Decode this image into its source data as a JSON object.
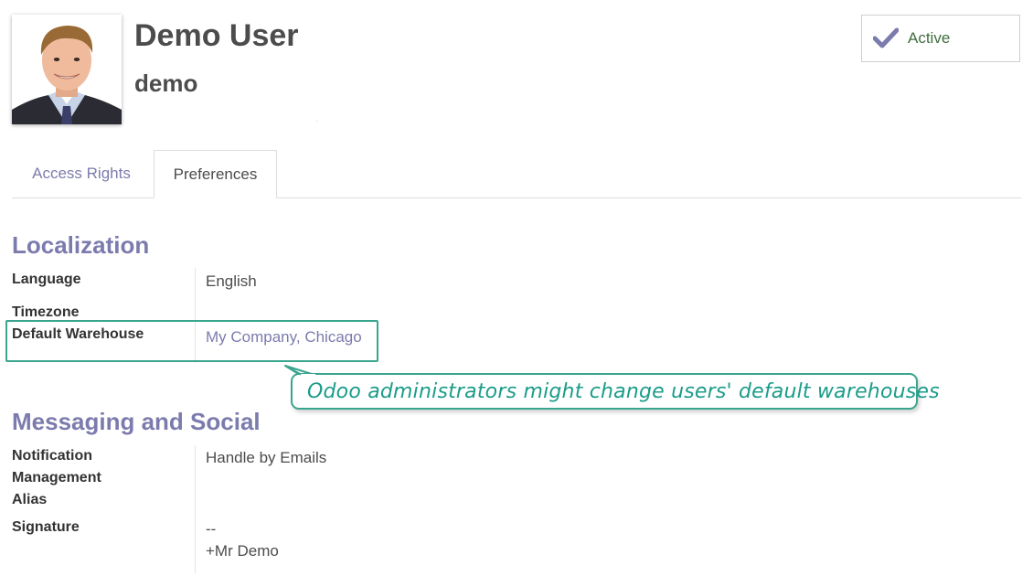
{
  "user": {
    "name": "Demo User",
    "login": "demo"
  },
  "status": {
    "label": "Active"
  },
  "tabs": [
    {
      "label": "Access Rights",
      "active": false
    },
    {
      "label": "Preferences",
      "active": true
    }
  ],
  "localization": {
    "title": "Localization",
    "language_label": "Language",
    "language_value": "English",
    "timezone_label": "Timezone",
    "warehouse_label": "Default Warehouse",
    "warehouse_value": "My Company, Chicago"
  },
  "messaging": {
    "title": "Messaging and Social",
    "notification_label_1": "Notification",
    "notification_label_2": "Management",
    "notification_label_3": "Alias",
    "notification_value": "Handle by Emails",
    "signature_label": "Signature",
    "signature_line_1": "--",
    "signature_line_2": "+Mr Demo"
  },
  "callout": {
    "text": "Odoo administrators might change users' default warehouses"
  },
  "colors": {
    "accent": "#7c7bad",
    "highlight": "#3aa58e",
    "callout_text": "#1b9c8a",
    "active_text": "#3f6d3f"
  },
  "icons": {
    "status": "check-icon"
  }
}
